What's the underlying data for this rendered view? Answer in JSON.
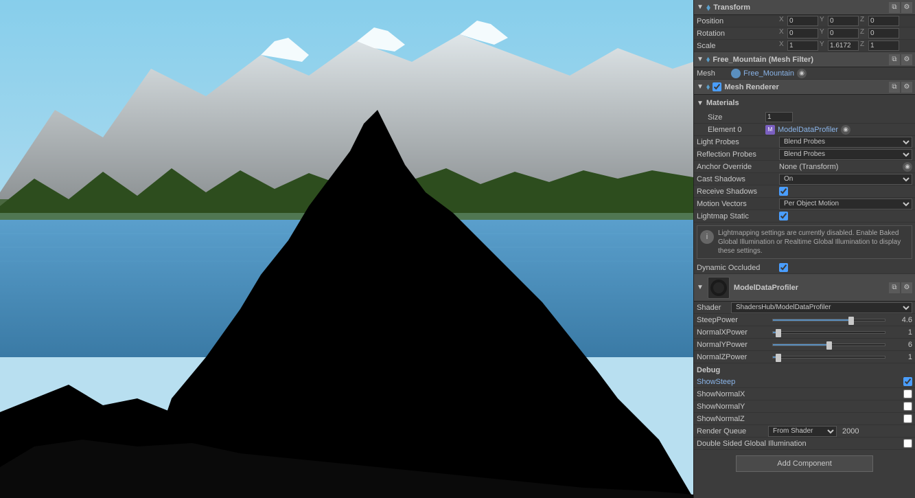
{
  "viewport": {
    "alt": "Mountain scene viewport"
  },
  "inspector": {
    "transform": {
      "title": "Transform",
      "position": {
        "label": "Position",
        "x": "0",
        "y": "0",
        "z": "0"
      },
      "rotation": {
        "label": "Rotation",
        "x": "0",
        "y": "0",
        "z": "0"
      },
      "scale": {
        "label": "Scale",
        "x": "1",
        "y": "1.6172",
        "z": "1"
      }
    },
    "meshFilter": {
      "title": "Free_Mountain (Mesh Filter)",
      "mesh_label": "Mesh",
      "mesh_value": "Free_Mountain"
    },
    "meshRenderer": {
      "title": "Mesh Renderer",
      "materials_label": "Materials",
      "size_label": "Size",
      "size_value": "1",
      "element0_label": "Element 0",
      "element0_value": "ModelDataProfiler",
      "light_probes_label": "Light Probes",
      "light_probes_value": "Blend Probes",
      "reflection_probes_label": "Reflection Probes",
      "reflection_probes_value": "Blend Probes",
      "anchor_override_label": "Anchor Override",
      "anchor_override_value": "None (Transform)",
      "cast_shadows_label": "Cast Shadows",
      "cast_shadows_value": "On",
      "receive_shadows_label": "Receive Shadows",
      "motion_vectors_label": "Motion Vectors",
      "motion_vectors_value": "Per Object Motion",
      "lightmap_static_label": "Lightmap Static",
      "dynamic_occluded_label": "Dynamic Occluded",
      "info_text": "Lightmapping settings are currently disabled. Enable Baked Global Illumination or Realtime Global Illumination to display these settings."
    },
    "material": {
      "title": "ModelDataProfiler",
      "shader_label": "Shader",
      "shader_value": "ShadersHub/ModelDataProfiler",
      "steep_power_label": "SteepPower",
      "steep_power_value": "4.6",
      "steep_power_pct": 70,
      "normalx_power_label": "NormalXPower",
      "normalx_power_value": "1",
      "normalx_power_pct": 5,
      "normaly_power_label": "NormalYPower",
      "normaly_power_value": "6",
      "normaly_power_pct": 50,
      "normalz_power_label": "NormalZPower",
      "normalz_power_value": "1",
      "normalz_power_pct": 5
    },
    "debug": {
      "title": "Debug",
      "show_steep_label": "ShowSteep",
      "show_normalx_label": "ShowNormalX",
      "show_normaly_label": "ShowNormalY",
      "show_normalz_label": "ShowNormalZ"
    },
    "renderQueue": {
      "label": "Render Queue",
      "dropdown_value": "From Shader",
      "value": "2000",
      "double_sided_label": "Double Sided Global Illumination"
    },
    "addComponent": {
      "label": "Add Component"
    }
  }
}
